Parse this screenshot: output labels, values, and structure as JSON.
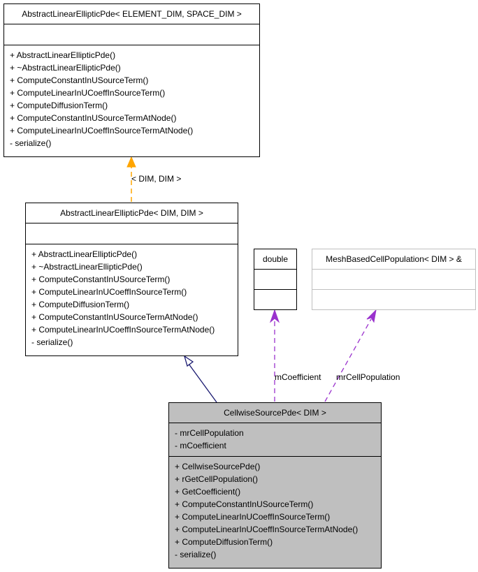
{
  "classes": {
    "base": {
      "name": "AbstractLinearEllipticPde< ELEMENT_DIM, SPACE_DIM >",
      "attributes": [],
      "methods": [
        "+ AbstractLinearEllipticPde()",
        "+ ~AbstractLinearEllipticPde()",
        "+ ComputeConstantInUSourceTerm()",
        "+ ComputeLinearInUCoeffInSourceTerm()",
        "+ ComputeDiffusionTerm()",
        "+ ComputeConstantInUSourceTermAtNode()",
        "+ ComputeLinearInUCoeffInSourceTermAtNode()",
        "- serialize()"
      ]
    },
    "instantiation": {
      "name": "AbstractLinearEllipticPde< DIM, DIM >",
      "attributes": [],
      "methods": [
        "+ AbstractLinearEllipticPde()",
        "+ ~AbstractLinearEllipticPde()",
        "+ ComputeConstantInUSourceTerm()",
        "+ ComputeLinearInUCoeffInSourceTerm()",
        "+ ComputeDiffusionTerm()",
        "+ ComputeConstantInUSourceTermAtNode()",
        "+ ComputeLinearInUCoeffInSourceTermAtNode()",
        "- serialize()"
      ]
    },
    "double": {
      "name": "double",
      "attributes": [],
      "methods": []
    },
    "mesh": {
      "name": "MeshBasedCellPopulation< DIM > &",
      "attributes": [],
      "methods": []
    },
    "cellwise": {
      "name": "CellwiseSourcePde< DIM >",
      "attributes": [
        "- mrCellPopulation",
        "- mCoefficient"
      ],
      "methods": [
        "+ CellwiseSourcePde()",
        "+ rGetCellPopulation()",
        "+ GetCoefficient()",
        "+ ComputeConstantInUSourceTerm()",
        "+ ComputeLinearInUCoeffInSourceTerm()",
        "+ ComputeLinearInUCoeffInSourceTermAtNode()",
        "+ ComputeDiffusionTerm()",
        "- serialize()"
      ]
    }
  },
  "edges": {
    "template": {
      "label": "< DIM, DIM >",
      "color": "#ffa500",
      "style": "dashed"
    },
    "inheritance": {
      "label": "",
      "color": "#191970",
      "style": "solid"
    },
    "coefficient": {
      "label": "mCoefficient",
      "color": "#9a32cd",
      "style": "dashed"
    },
    "population": {
      "label": "mrCellPopulation",
      "color": "#9a32cd",
      "style": "dashed"
    }
  }
}
